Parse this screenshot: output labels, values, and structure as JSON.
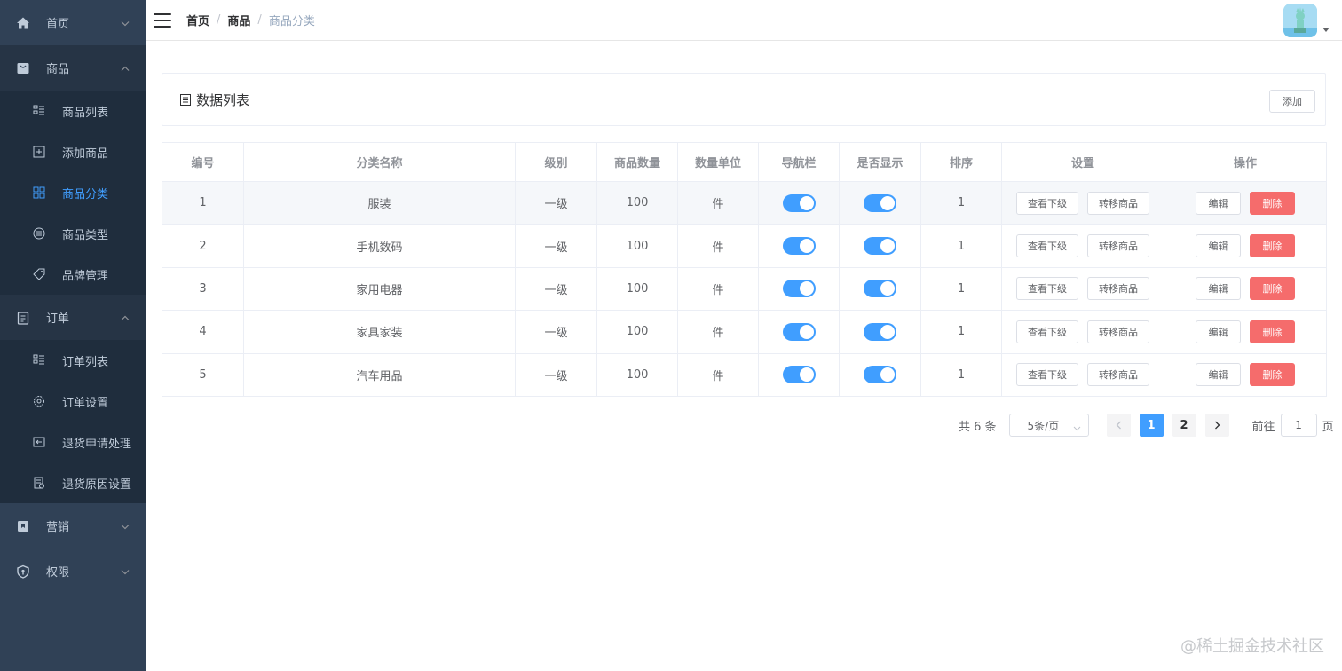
{
  "sidebar": {
    "home": "首页",
    "goods": {
      "label": "商品",
      "items": [
        "商品列表",
        "添加商品",
        "商品分类",
        "商品类型",
        "品牌管理"
      ]
    },
    "order": {
      "label": "订单",
      "items": [
        "订单列表",
        "订单设置",
        "退货申请处理",
        "退货原因设置"
      ]
    },
    "marketing": "营销",
    "permission": "权限"
  },
  "breadcrumb": {
    "home": "首页",
    "goods": "商品",
    "current": "商品分类",
    "sep": "/"
  },
  "card": {
    "title": "数据列表",
    "add_label": "添加"
  },
  "table": {
    "headers": [
      "编号",
      "分类名称",
      "级别",
      "商品数量",
      "数量单位",
      "导航栏",
      "是否显示",
      "排序",
      "设置",
      "操作"
    ],
    "rows": [
      {
        "id": "1",
        "name": "服装",
        "level": "一级",
        "count": "100",
        "unit": "件",
        "sort": "1",
        "nav": true,
        "show": true
      },
      {
        "id": "2",
        "name": "手机数码",
        "level": "一级",
        "count": "100",
        "unit": "件",
        "sort": "1",
        "nav": true,
        "show": true
      },
      {
        "id": "3",
        "name": "家用电器",
        "level": "一级",
        "count": "100",
        "unit": "件",
        "sort": "1",
        "nav": true,
        "show": true
      },
      {
        "id": "4",
        "name": "家具家装",
        "level": "一级",
        "count": "100",
        "unit": "件",
        "sort": "1",
        "nav": true,
        "show": true
      },
      {
        "id": "5",
        "name": "汽车用品",
        "level": "一级",
        "count": "100",
        "unit": "件",
        "sort": "1",
        "nav": true,
        "show": true
      }
    ],
    "btn_view_sub": "查看下级",
    "btn_transfer": "转移商品",
    "btn_edit": "编辑",
    "btn_delete": "删除"
  },
  "pagination": {
    "total": "共 6 条",
    "page_size": "5条/页",
    "pages": [
      "1",
      "2"
    ],
    "current": "1",
    "goto_prefix": "前往",
    "goto_value": "1",
    "goto_suffix": "页"
  },
  "watermark": "@稀土掘金技术社区",
  "colors": {
    "sidebar_bg": "#304156",
    "submenu_bg": "#1f2d3d",
    "accent": "#409eff",
    "danger": "#f56c6c"
  }
}
